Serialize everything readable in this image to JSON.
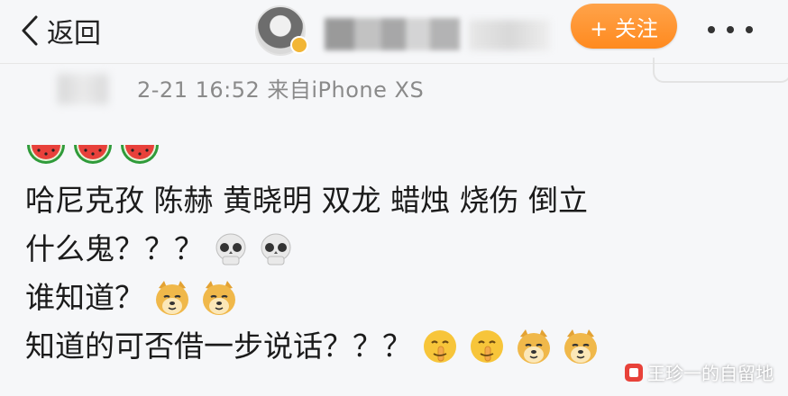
{
  "header": {
    "back_label": "返回",
    "follow_label": "+ 关注",
    "more_icon": "more-dots-icon"
  },
  "post": {
    "meta": "2-21 16:52  来自iPhone XS",
    "lines": [
      {
        "text": "",
        "emojis": [
          "watermelon",
          "watermelon",
          "watermelon"
        ]
      },
      {
        "text": "哈尼克孜 陈赫 黄晓明 双龙 蜡烛 烧伤 倒立",
        "emojis": []
      },
      {
        "text": "什么鬼？？？",
        "emojis": [
          "skull",
          "skull"
        ]
      },
      {
        "text": "谁知道？",
        "emojis": [
          "doge",
          "doge"
        ]
      },
      {
        "text": "知道的可否借一步说话？？？",
        "emojis": [
          "shush",
          "shush",
          "doge",
          "doge"
        ]
      }
    ]
  },
  "watermark": {
    "text": "王珍一的自留地"
  },
  "colors": {
    "follow_orange": "#ff8a1f",
    "meta_gray": "#8a8a8a",
    "background": "#f6f7f9"
  }
}
